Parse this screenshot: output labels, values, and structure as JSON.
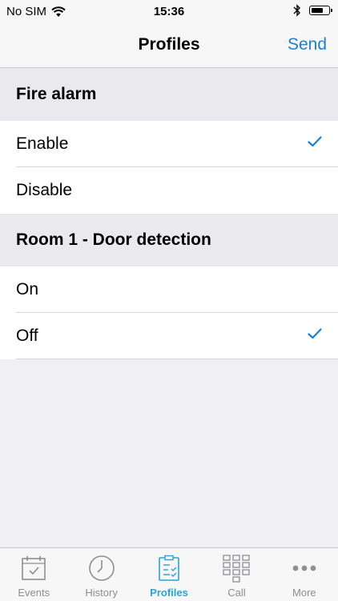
{
  "status_bar": {
    "carrier": "No SIM",
    "time": "15:36"
  },
  "nav": {
    "title": "Profiles",
    "send_label": "Send"
  },
  "sections": [
    {
      "header": "Fire alarm",
      "options": [
        {
          "label": "Enable",
          "selected": true
        },
        {
          "label": "Disable",
          "selected": false
        }
      ]
    },
    {
      "header": "Room 1 - Door detection",
      "options": [
        {
          "label": "On",
          "selected": false
        },
        {
          "label": "Off",
          "selected": true
        }
      ]
    }
  ],
  "tabs": [
    {
      "label": "Events",
      "icon": "calendar-icon",
      "active": false
    },
    {
      "label": "History",
      "icon": "clock-icon",
      "active": false
    },
    {
      "label": "Profiles",
      "icon": "clipboard-icon",
      "active": true
    },
    {
      "label": "Call",
      "icon": "keypad-icon",
      "active": false
    },
    {
      "label": "More",
      "icon": "more-icon",
      "active": false
    }
  ],
  "colors": {
    "accent": "#1a7fd6",
    "tab_active": "#2aa3d8",
    "tab_inactive": "#8e8e93",
    "background": "#efeff4"
  }
}
